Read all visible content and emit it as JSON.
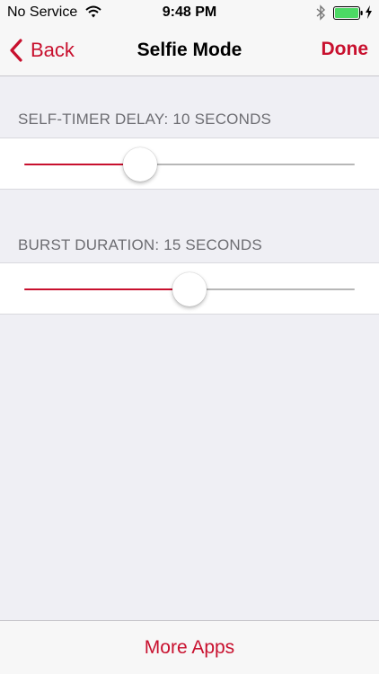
{
  "status_bar": {
    "carrier": "No Service",
    "time": "9:48 PM",
    "icons": [
      "wifi-icon",
      "bluetooth-icon",
      "battery-icon",
      "charging-icon"
    ],
    "battery_level": 1.0
  },
  "nav": {
    "back_label": "Back",
    "title": "Selfie Mode",
    "done_label": "Done"
  },
  "settings": [
    {
      "label": "SELF-TIMER DELAY: 10 SECONDS",
      "value_fraction": 0.35
    },
    {
      "label": "BURST DURATION: 15 SECONDS",
      "value_fraction": 0.5
    }
  ],
  "footer": {
    "more_apps_label": "More Apps"
  },
  "colors": {
    "accent": "#c8102e",
    "background": "#efeff4",
    "track": "#b7b7b7",
    "battery": "#4cd964"
  }
}
